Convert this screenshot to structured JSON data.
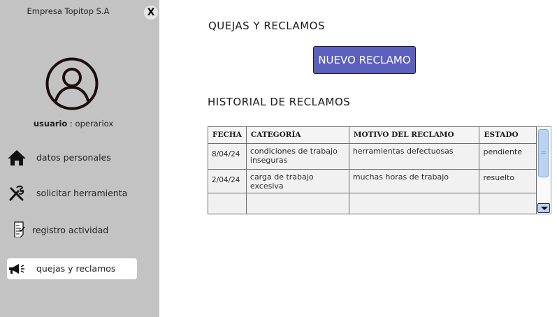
{
  "sidebar": {
    "company": "Empresa Topitop S.A",
    "close_label": "X",
    "user_label": "usuario",
    "user_value": " : operariox",
    "items": [
      {
        "label": "datos personales",
        "icon": "home-icon"
      },
      {
        "label": "solicitar herramienta",
        "icon": "tools-icon"
      },
      {
        "label": "registro actividad",
        "icon": "checklist-icon"
      },
      {
        "label": "quejas y reclamos",
        "icon": "megaphone-icon",
        "active": true
      }
    ]
  },
  "main": {
    "title": "QUEJAS Y RECLAMOS",
    "new_button": "NUEVO RECLAMO",
    "history_title": "HISTORIAL DE RECLAMOS",
    "table": {
      "headers": [
        "FECHA",
        "CATEGORÍA",
        "MOTIVO DEL RECLAMO",
        "ESTADO"
      ],
      "rows": [
        [
          "8/04/24",
          "condiciones de trabajo inseguras",
          "herramientas defectuosas",
          "pendiente"
        ],
        [
          "2/04/24",
          "carga de trabajo excesiva",
          "muchas horas de trabajo",
          "resuelto"
        ],
        [
          "",
          "",
          "",
          ""
        ]
      ]
    }
  },
  "colors": {
    "sidebar_bg": "#c3c3c3",
    "button_bg": "#5b5fbd",
    "scroll_thumb": "#bcd3ef"
  }
}
